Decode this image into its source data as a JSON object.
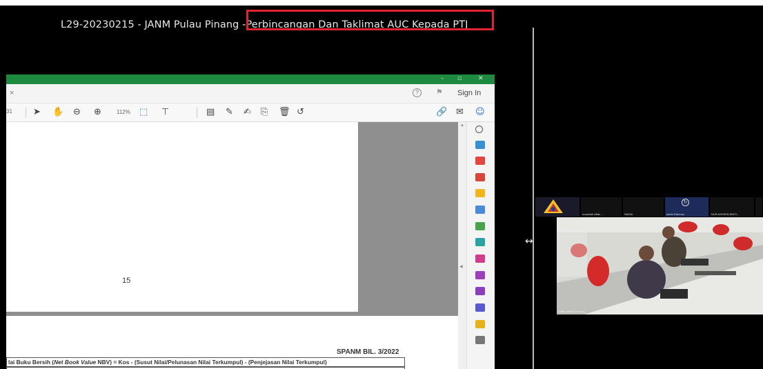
{
  "meeting": {
    "title_prefix": "L29-20230215 - JANM Pulau Pinang - ",
    "title_highlight": "Perbincangan Dan Taklimat AUC Kepada PTJ"
  },
  "pdf_viewer": {
    "window_controls": [
      "–",
      "▫",
      "✕"
    ],
    "tab_close": "×",
    "sign_in": "Sign In",
    "page_indicator": "31",
    "zoom": "112%",
    "page_number_text": "15",
    "doc_header": "SPANM BIL. 3/2022",
    "formula": {
      "start": "lai Buku Bersih (",
      "net_book_value": "Net Book Value",
      "rest": " NBV) = Kos - (Susut Nilai/Pelunasan Nilai Terkumpul) - (Penjejasan Nilai Terkumpul)"
    },
    "toolbar_icons": [
      "select-icon",
      "hand-icon",
      "zoom-out-icon",
      "zoom-in-icon",
      "fit-icon",
      "stamp-icon",
      "comment-icon",
      "pen-icon",
      "sign-icon",
      "share-icon",
      "delete-icon",
      "undo-icon",
      "link-icon",
      "mail-icon",
      "user-icon"
    ],
    "colors": {
      "titlebar": "#1e8a3f",
      "highlight": "#e0242f"
    }
  },
  "participants": {
    "tiles": [
      {
        "name": "LOGO"
      },
      {
        "name": "norazilah Affan ..."
      },
      {
        "name": "NADIA"
      },
      {
        "name": "sarita Rahman"
      },
      {
        "name": "NUR ASHIKIN BINTI..."
      },
      {
        "name": "..."
      }
    ],
    "main_video_label": "ANM JANM P.Pinang"
  }
}
